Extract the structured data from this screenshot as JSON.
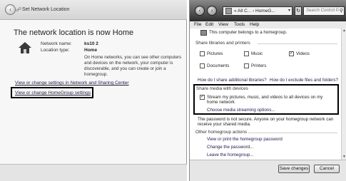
{
  "left_window": {
    "title": "Set Network Location",
    "heading": "The network location is now Home",
    "network_name_label": "Network name:",
    "network_name_value": "ks10 2",
    "location_type_label": "Location type:",
    "location_type_value": "Home",
    "description": "On Home networks, you can see other computers and devices on the network, your computer is discoverable, and you can create or join a homegroup.",
    "link_sharing": "View or change settings in Network and Sharing Center",
    "link_homegroup": "View or change HomeGroup settings"
  },
  "right_window": {
    "address": "« All C... › HomeG...",
    "search_placeholder": "Search Control P...",
    "menu": [
      "File",
      "Edit",
      "View",
      "Tools",
      "Help"
    ],
    "belongs_text": "This computer belongs to a homegroup.",
    "share_section": "Share libraries and printers",
    "libraries": [
      {
        "label": "Pictures",
        "checked": false
      },
      {
        "label": "Music",
        "checked": false
      },
      {
        "label": "Videos",
        "checked": true
      },
      {
        "label": "Documents",
        "checked": false
      },
      {
        "label": "Printers",
        "checked": false
      }
    ],
    "link_share_libraries": "How do I share additional libraries?",
    "link_exclude": "How do I exclude files and folders?",
    "media_section": "Share media with devices",
    "stream_text": "Stream my pictures, music, and videos to all devices on my home network",
    "stream_checked": true,
    "link_media_streaming": "Choose media streaming options...",
    "password_note": "The password is not secure. Anyone on your homegroup network can receive your shared media.",
    "other_actions_section": "Other homegroup actions",
    "actions": [
      "View or print the homegroup password",
      "Change the password...",
      "Leave the homegroup..."
    ],
    "save_button": "Save changes",
    "cancel_button": "Cancel"
  }
}
